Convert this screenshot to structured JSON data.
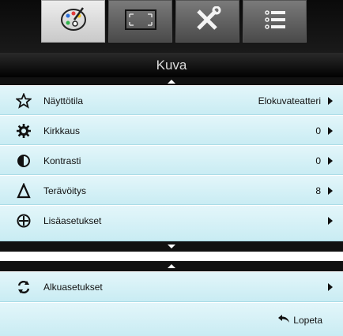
{
  "tabs": [
    {
      "id": "picture",
      "icon": "palette-icon",
      "active": true
    },
    {
      "id": "display",
      "icon": "screen-corners-icon",
      "active": false
    },
    {
      "id": "setup",
      "icon": "tools-icon",
      "active": false
    },
    {
      "id": "options",
      "icon": "list-icon",
      "active": false
    }
  ],
  "menu": {
    "title": "Kuva",
    "items": [
      {
        "label": "Näyttötila",
        "value": "Elokuvateatteri",
        "icon": "star-outline-icon"
      },
      {
        "label": "Kirkkaus",
        "value": "0",
        "icon": "brightness-gear-icon"
      },
      {
        "label": "Kontrasti",
        "value": "0",
        "icon": "contrast-half-circle-icon"
      },
      {
        "label": "Terävöitys",
        "value": "8",
        "icon": "sharpness-delta-icon"
      },
      {
        "label": "Lisäasetukset",
        "value": "",
        "icon": "advanced-circle-plus-icon"
      }
    ]
  },
  "reset": {
    "label": "Alkuasetukset",
    "icon": "refresh-icon"
  },
  "exit": {
    "label": "Lopeta",
    "icon": "return-arrow-icon"
  }
}
